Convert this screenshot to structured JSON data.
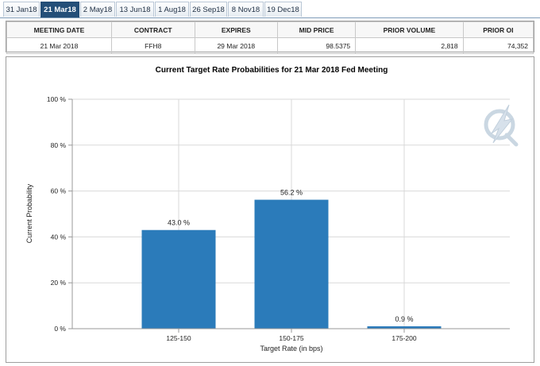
{
  "tabs": [
    {
      "label": "31 Jan18",
      "active": false
    },
    {
      "label": "21 Mar18",
      "active": true
    },
    {
      "label": "2 May18",
      "active": false
    },
    {
      "label": "13 Jun18",
      "active": false
    },
    {
      "label": "1 Aug18",
      "active": false
    },
    {
      "label": "26 Sep18",
      "active": false
    },
    {
      "label": "8 Nov18",
      "active": false
    },
    {
      "label": "19 Dec18",
      "active": false
    }
  ],
  "info_table": {
    "headers": [
      "MEETING DATE",
      "CONTRACT",
      "EXPIRES",
      "MID PRICE",
      "PRIOR VOLUME",
      "PRIOR OI"
    ],
    "row": [
      "21 Mar 2018",
      "FFH8",
      "29 Mar 2018",
      "98.5375",
      "2,818",
      "74,352"
    ]
  },
  "chart_data": {
    "type": "bar",
    "title": "Current Target Rate Probabilities for 21 Mar 2018 Fed Meeting",
    "xlabel": "Target Rate (in bps)",
    "ylabel": "Current Probability",
    "categories": [
      "125-150",
      "150-175",
      "175-200"
    ],
    "values": [
      43.0,
      56.2,
      0.9
    ],
    "data_labels": [
      "43.0 %",
      "56.2 %",
      "0.9 %"
    ],
    "ylim": [
      0,
      100
    ],
    "yticks": [
      0,
      20,
      40,
      60,
      80,
      100
    ],
    "ytick_labels": [
      "0 %",
      "20 %",
      "40 %",
      "60 %",
      "80 %",
      "100 %"
    ],
    "grid": true,
    "bar_color": "#2b7bba"
  },
  "colors": {
    "tab_active": "#244f78",
    "bar": "#2b7bba",
    "grid": "#d9d9d9",
    "watermark": "#9fb7cc"
  },
  "watermark_icon": "cme-quikstrike-logo-icon"
}
